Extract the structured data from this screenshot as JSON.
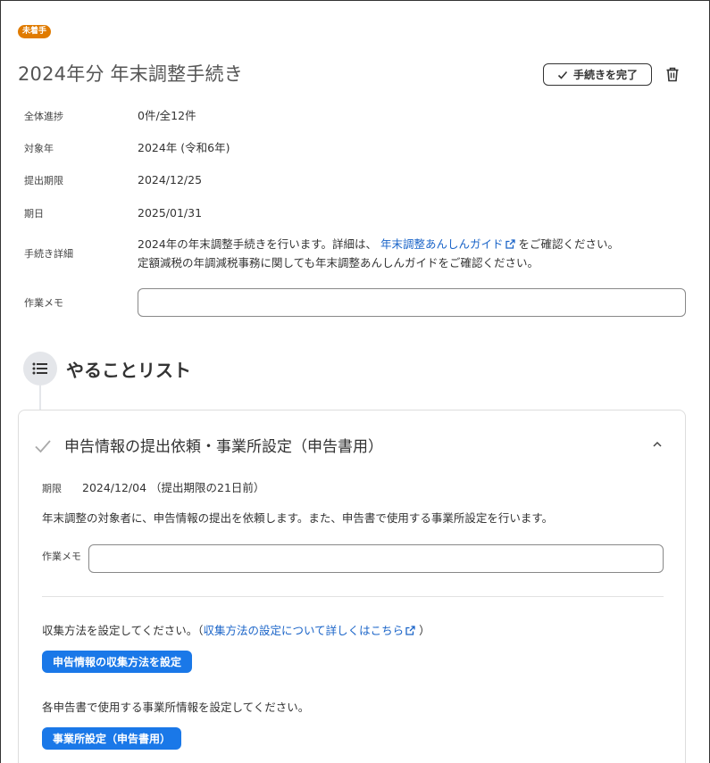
{
  "header": {
    "status_badge": "未着手",
    "title": "2024年分 年末調整手続き",
    "complete_button": "手続きを完了"
  },
  "info": {
    "progress_label": "全体進捗",
    "progress_value": "0件/全12件",
    "year_label": "対象年",
    "year_value": "2024年 (令和6年)",
    "deadline_label": "提出期限",
    "deadline_value": "2024/12/25",
    "due_label": "期日",
    "due_value": "2025/01/31",
    "detail_label": "手続き詳細",
    "detail_line1_before": "2024年の年末調整手続きを行います。詳細は、",
    "detail_link": "年末調整あんしんガイド",
    "detail_line1_after": "をご確認ください。",
    "detail_line2": "定額減税の年調減税事務に関しても年末調整あんしんガイドをご確認ください。",
    "memo_label": "作業メモ",
    "memo_value": ""
  },
  "todo": {
    "title": "やることリスト",
    "card": {
      "title": "申告情報の提出依頼・事業所設定（申告書用）",
      "deadline_label": "期限",
      "deadline_value": "2024/12/04 （提出期限の21日前）",
      "description": "年末調整の対象者に、申告情報の提出を依頼します。また、申告書で使用する事業所設定を行います。",
      "memo_label": "作業メモ",
      "memo_value": "",
      "collect_text_before": "収集方法を設定してください。（",
      "collect_link": "収集方法の設定について詳しくはこちら",
      "collect_text_after": "）",
      "collect_button": "申告情報の収集方法を設定",
      "office_text": "各申告書で使用する事業所情報を設定してください。",
      "office_button": "事業所設定（申告書用）"
    }
  },
  "colors": {
    "badge": "#e07b00",
    "link": "#1a64c8",
    "primary_button": "#1a78e8"
  }
}
